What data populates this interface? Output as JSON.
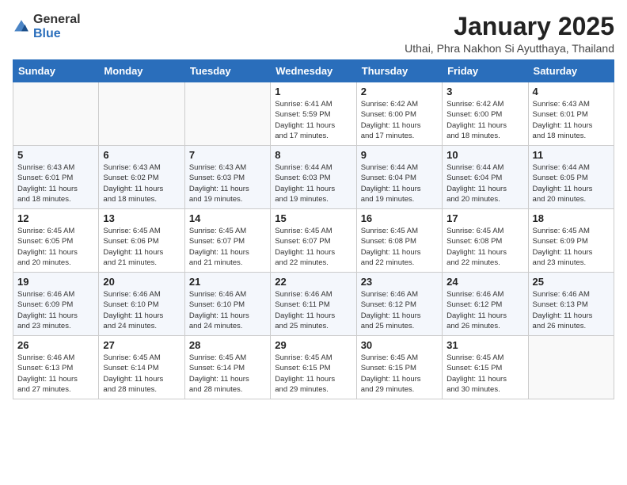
{
  "header": {
    "logo_general": "General",
    "logo_blue": "Blue",
    "month_title": "January 2025",
    "subtitle": "Uthai, Phra Nakhon Si Ayutthaya, Thailand"
  },
  "weekdays": [
    "Sunday",
    "Monday",
    "Tuesday",
    "Wednesday",
    "Thursday",
    "Friday",
    "Saturday"
  ],
  "weeks": [
    [
      {
        "day": "",
        "info": ""
      },
      {
        "day": "",
        "info": ""
      },
      {
        "day": "",
        "info": ""
      },
      {
        "day": "1",
        "info": "Sunrise: 6:41 AM\nSunset: 5:59 PM\nDaylight: 11 hours\nand 17 minutes."
      },
      {
        "day": "2",
        "info": "Sunrise: 6:42 AM\nSunset: 6:00 PM\nDaylight: 11 hours\nand 17 minutes."
      },
      {
        "day": "3",
        "info": "Sunrise: 6:42 AM\nSunset: 6:00 PM\nDaylight: 11 hours\nand 18 minutes."
      },
      {
        "day": "4",
        "info": "Sunrise: 6:43 AM\nSunset: 6:01 PM\nDaylight: 11 hours\nand 18 minutes."
      }
    ],
    [
      {
        "day": "5",
        "info": "Sunrise: 6:43 AM\nSunset: 6:01 PM\nDaylight: 11 hours\nand 18 minutes."
      },
      {
        "day": "6",
        "info": "Sunrise: 6:43 AM\nSunset: 6:02 PM\nDaylight: 11 hours\nand 18 minutes."
      },
      {
        "day": "7",
        "info": "Sunrise: 6:43 AM\nSunset: 6:03 PM\nDaylight: 11 hours\nand 19 minutes."
      },
      {
        "day": "8",
        "info": "Sunrise: 6:44 AM\nSunset: 6:03 PM\nDaylight: 11 hours\nand 19 minutes."
      },
      {
        "day": "9",
        "info": "Sunrise: 6:44 AM\nSunset: 6:04 PM\nDaylight: 11 hours\nand 19 minutes."
      },
      {
        "day": "10",
        "info": "Sunrise: 6:44 AM\nSunset: 6:04 PM\nDaylight: 11 hours\nand 20 minutes."
      },
      {
        "day": "11",
        "info": "Sunrise: 6:44 AM\nSunset: 6:05 PM\nDaylight: 11 hours\nand 20 minutes."
      }
    ],
    [
      {
        "day": "12",
        "info": "Sunrise: 6:45 AM\nSunset: 6:05 PM\nDaylight: 11 hours\nand 20 minutes."
      },
      {
        "day": "13",
        "info": "Sunrise: 6:45 AM\nSunset: 6:06 PM\nDaylight: 11 hours\nand 21 minutes."
      },
      {
        "day": "14",
        "info": "Sunrise: 6:45 AM\nSunset: 6:07 PM\nDaylight: 11 hours\nand 21 minutes."
      },
      {
        "day": "15",
        "info": "Sunrise: 6:45 AM\nSunset: 6:07 PM\nDaylight: 11 hours\nand 22 minutes."
      },
      {
        "day": "16",
        "info": "Sunrise: 6:45 AM\nSunset: 6:08 PM\nDaylight: 11 hours\nand 22 minutes."
      },
      {
        "day": "17",
        "info": "Sunrise: 6:45 AM\nSunset: 6:08 PM\nDaylight: 11 hours\nand 22 minutes."
      },
      {
        "day": "18",
        "info": "Sunrise: 6:45 AM\nSunset: 6:09 PM\nDaylight: 11 hours\nand 23 minutes."
      }
    ],
    [
      {
        "day": "19",
        "info": "Sunrise: 6:46 AM\nSunset: 6:09 PM\nDaylight: 11 hours\nand 23 minutes."
      },
      {
        "day": "20",
        "info": "Sunrise: 6:46 AM\nSunset: 6:10 PM\nDaylight: 11 hours\nand 24 minutes."
      },
      {
        "day": "21",
        "info": "Sunrise: 6:46 AM\nSunset: 6:10 PM\nDaylight: 11 hours\nand 24 minutes."
      },
      {
        "day": "22",
        "info": "Sunrise: 6:46 AM\nSunset: 6:11 PM\nDaylight: 11 hours\nand 25 minutes."
      },
      {
        "day": "23",
        "info": "Sunrise: 6:46 AM\nSunset: 6:12 PM\nDaylight: 11 hours\nand 25 minutes."
      },
      {
        "day": "24",
        "info": "Sunrise: 6:46 AM\nSunset: 6:12 PM\nDaylight: 11 hours\nand 26 minutes."
      },
      {
        "day": "25",
        "info": "Sunrise: 6:46 AM\nSunset: 6:13 PM\nDaylight: 11 hours\nand 26 minutes."
      }
    ],
    [
      {
        "day": "26",
        "info": "Sunrise: 6:46 AM\nSunset: 6:13 PM\nDaylight: 11 hours\nand 27 minutes."
      },
      {
        "day": "27",
        "info": "Sunrise: 6:45 AM\nSunset: 6:14 PM\nDaylight: 11 hours\nand 28 minutes."
      },
      {
        "day": "28",
        "info": "Sunrise: 6:45 AM\nSunset: 6:14 PM\nDaylight: 11 hours\nand 28 minutes."
      },
      {
        "day": "29",
        "info": "Sunrise: 6:45 AM\nSunset: 6:15 PM\nDaylight: 11 hours\nand 29 minutes."
      },
      {
        "day": "30",
        "info": "Sunrise: 6:45 AM\nSunset: 6:15 PM\nDaylight: 11 hours\nand 29 minutes."
      },
      {
        "day": "31",
        "info": "Sunrise: 6:45 AM\nSunset: 6:15 PM\nDaylight: 11 hours\nand 30 minutes."
      },
      {
        "day": "",
        "info": ""
      }
    ]
  ]
}
